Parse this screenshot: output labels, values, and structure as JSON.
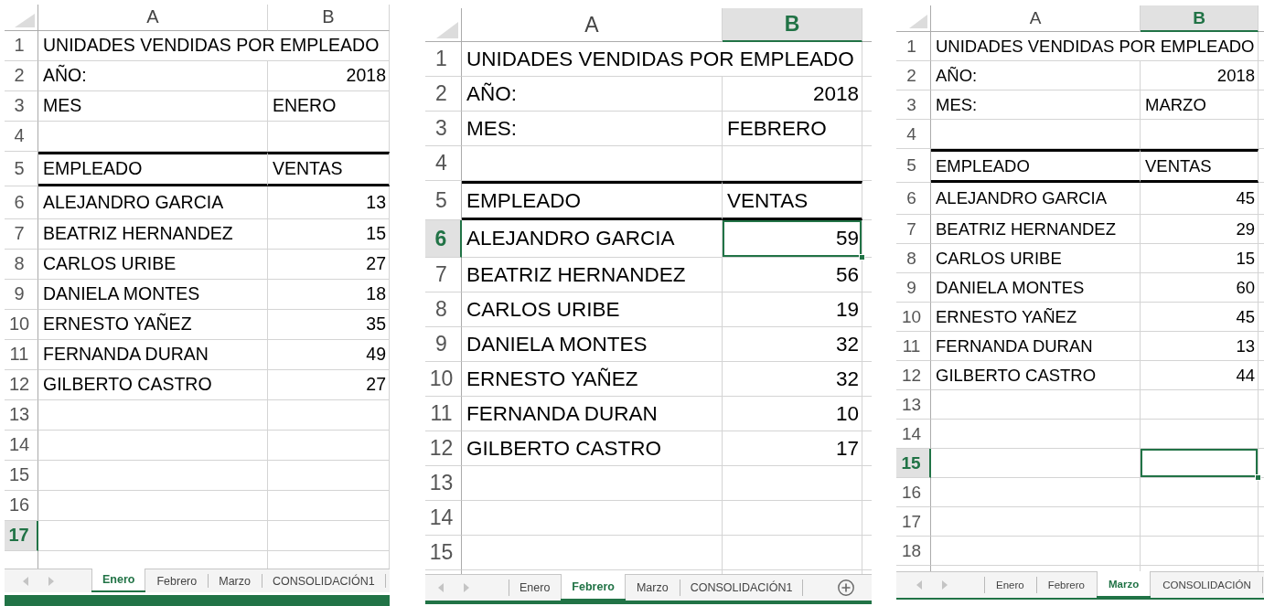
{
  "sheets": [
    {
      "columns": [
        {
          "label": "A",
          "selected": false
        },
        {
          "label": "B",
          "selected": false
        }
      ],
      "rows": [
        {
          "number": "1",
          "selected": false,
          "cells": [
            {
              "text": "UNIDADES VENDIDAS POR EMPLEADO",
              "kind": "title",
              "selected": false
            }
          ]
        },
        {
          "number": "2",
          "selected": false,
          "cells": [
            {
              "text": "AÑO:",
              "kind": "text",
              "selected": false
            },
            {
              "text": "2018",
              "kind": "number",
              "selected": false
            }
          ]
        },
        {
          "number": "3",
          "selected": false,
          "cells": [
            {
              "text": "MES",
              "kind": "text",
              "selected": false
            },
            {
              "text": "ENERO",
              "kind": "text",
              "selected": false
            }
          ]
        },
        {
          "number": "4",
          "selected": false,
          "cells": [
            {
              "selected": false
            },
            {
              "selected": false
            }
          ]
        },
        {
          "number": "5",
          "selected": false,
          "cells": [
            {
              "text": "EMPLEADO",
              "kind": "heading",
              "selected": false
            },
            {
              "text": "VENTAS",
              "kind": "heading",
              "selected": false
            }
          ]
        },
        {
          "number": "6",
          "selected": false,
          "cells": [
            {
              "text": "ALEJANDRO GARCIA",
              "kind": "text",
              "selected": false
            },
            {
              "text": "13",
              "kind": "number",
              "selected": false
            }
          ]
        },
        {
          "number": "7",
          "selected": false,
          "cells": [
            {
              "text": "BEATRIZ HERNANDEZ",
              "kind": "text",
              "selected": false
            },
            {
              "text": "15",
              "kind": "number",
              "selected": false
            }
          ]
        },
        {
          "number": "8",
          "selected": false,
          "cells": [
            {
              "text": "CARLOS URIBE",
              "kind": "text",
              "selected": false
            },
            {
              "text": "27",
              "kind": "number",
              "selected": false
            }
          ]
        },
        {
          "number": "9",
          "selected": false,
          "cells": [
            {
              "text": "DANIELA MONTES",
              "kind": "text",
              "selected": false
            },
            {
              "text": "18",
              "kind": "number",
              "selected": false
            }
          ]
        },
        {
          "number": "10",
          "selected": false,
          "cells": [
            {
              "text": "ERNESTO YAÑEZ",
              "kind": "text",
              "selected": false
            },
            {
              "text": "35",
              "kind": "number",
              "selected": false
            }
          ]
        },
        {
          "number": "11",
          "selected": false,
          "cells": [
            {
              "text": "FERNANDA DURAN",
              "kind": "text",
              "selected": false
            },
            {
              "text": "49",
              "kind": "number",
              "selected": false
            }
          ]
        },
        {
          "number": "12",
          "selected": false,
          "cells": [
            {
              "text": "GILBERTO CASTRO",
              "kind": "text",
              "selected": false
            },
            {
              "text": "27",
              "kind": "number",
              "selected": false
            }
          ]
        },
        {
          "number": "13",
          "selected": false,
          "cells": [
            {
              "selected": false
            },
            {
              "selected": false
            }
          ]
        },
        {
          "number": "14",
          "selected": false,
          "cells": [
            {
              "selected": false
            },
            {
              "selected": false
            }
          ]
        },
        {
          "number": "15",
          "selected": false,
          "cells": [
            {
              "selected": false
            },
            {
              "selected": false
            }
          ]
        },
        {
          "number": "16",
          "selected": false,
          "cells": [
            {
              "selected": false
            },
            {
              "selected": false
            }
          ]
        },
        {
          "number": "17",
          "selected": true,
          "cells": [
            {
              "selected": false
            },
            {
              "selected": false
            }
          ]
        }
      ],
      "tabs": [
        {
          "label": "Enero",
          "selected": true
        },
        {
          "label": "Febrero",
          "selected": false
        },
        {
          "label": "Marzo",
          "selected": false
        },
        {
          "label": "CONSOLIDACIÓN1",
          "selected": false
        }
      ]
    },
    {
      "columns": [
        {
          "label": "A",
          "selected": false
        },
        {
          "label": "B",
          "selected": true
        }
      ],
      "rows": [
        {
          "number": "1",
          "selected": false,
          "cells": [
            {
              "text": "UNIDADES VENDIDAS POR EMPLEADO",
              "kind": "title",
              "selected": false
            }
          ]
        },
        {
          "number": "2",
          "selected": false,
          "cells": [
            {
              "text": "AÑO:",
              "kind": "text",
              "selected": false
            },
            {
              "text": "2018",
              "kind": "number",
              "selected": false
            }
          ]
        },
        {
          "number": "3",
          "selected": false,
          "cells": [
            {
              "text": "MES:",
              "kind": "text",
              "selected": false
            },
            {
              "text": "FEBRERO",
              "kind": "text",
              "selected": false
            }
          ]
        },
        {
          "number": "4",
          "selected": false,
          "cells": [
            {
              "selected": false
            },
            {
              "selected": false
            }
          ]
        },
        {
          "number": "5",
          "selected": false,
          "cells": [
            {
              "text": "EMPLEADO",
              "kind": "heading",
              "selected": false
            },
            {
              "text": "VENTAS",
              "kind": "heading",
              "selected": false
            }
          ]
        },
        {
          "number": "6",
          "selected": true,
          "cells": [
            {
              "text": "ALEJANDRO GARCIA",
              "kind": "text",
              "selected": false
            },
            {
              "text": "59",
              "kind": "number",
              "selected": true
            }
          ]
        },
        {
          "number": "7",
          "selected": false,
          "cells": [
            {
              "text": "BEATRIZ HERNANDEZ",
              "kind": "text",
              "selected": false
            },
            {
              "text": "56",
              "kind": "number",
              "selected": false
            }
          ]
        },
        {
          "number": "8",
          "selected": false,
          "cells": [
            {
              "text": "CARLOS URIBE",
              "kind": "text",
              "selected": false
            },
            {
              "text": "19",
              "kind": "number",
              "selected": false
            }
          ]
        },
        {
          "number": "9",
          "selected": false,
          "cells": [
            {
              "text": "DANIELA MONTES",
              "kind": "text",
              "selected": false
            },
            {
              "text": "32",
              "kind": "number",
              "selected": false
            }
          ]
        },
        {
          "number": "10",
          "selected": false,
          "cells": [
            {
              "text": "ERNESTO YAÑEZ",
              "kind": "text",
              "selected": false
            },
            {
              "text": "32",
              "kind": "number",
              "selected": false
            }
          ]
        },
        {
          "number": "11",
          "selected": false,
          "cells": [
            {
              "text": "FERNANDA DURAN",
              "kind": "text",
              "selected": false
            },
            {
              "text": "10",
              "kind": "number",
              "selected": false
            }
          ]
        },
        {
          "number": "12",
          "selected": false,
          "cells": [
            {
              "text": "GILBERTO CASTRO",
              "kind": "text",
              "selected": false
            },
            {
              "text": "17",
              "kind": "number",
              "selected": false
            }
          ]
        },
        {
          "number": "13",
          "selected": false,
          "cells": [
            {
              "selected": false
            },
            {
              "selected": false
            }
          ]
        },
        {
          "number": "14",
          "selected": false,
          "cells": [
            {
              "selected": false
            },
            {
              "selected": false
            }
          ]
        },
        {
          "number": "15",
          "selected": false,
          "cells": [
            {
              "selected": false
            },
            {
              "selected": false
            }
          ]
        }
      ],
      "tabs": [
        {
          "label": "Enero",
          "selected": false
        },
        {
          "label": "Febrero",
          "selected": true
        },
        {
          "label": "Marzo",
          "selected": false
        },
        {
          "label": "CONSOLIDACIÓN1",
          "selected": false
        }
      ],
      "add_sheet_button": true
    },
    {
      "columns": [
        {
          "label": "A",
          "selected": false
        },
        {
          "label": "B",
          "selected": true
        }
      ],
      "rows": [
        {
          "number": "1",
          "selected": false,
          "cells": [
            {
              "text": "UNIDADES VENDIDAS POR EMPLEADO",
              "kind": "title",
              "selected": false
            }
          ]
        },
        {
          "number": "2",
          "selected": false,
          "cells": [
            {
              "text": "AÑO:",
              "kind": "text",
              "selected": false
            },
            {
              "text": "2018",
              "kind": "number",
              "selected": false
            }
          ]
        },
        {
          "number": "3",
          "selected": false,
          "cells": [
            {
              "text": "MES:",
              "kind": "text",
              "selected": false
            },
            {
              "text": "MARZO",
              "kind": "text",
              "selected": false
            }
          ]
        },
        {
          "number": "4",
          "selected": false,
          "cells": [
            {
              "selected": false
            },
            {
              "selected": false
            }
          ]
        },
        {
          "number": "5",
          "selected": false,
          "cells": [
            {
              "text": "EMPLEADO",
              "kind": "heading",
              "selected": false
            },
            {
              "text": "VENTAS",
              "kind": "heading",
              "selected": false
            }
          ]
        },
        {
          "number": "6",
          "selected": false,
          "cells": [
            {
              "text": "ALEJANDRO GARCIA",
              "kind": "text",
              "selected": false
            },
            {
              "text": "45",
              "kind": "number",
              "selected": false
            }
          ]
        },
        {
          "number": "7",
          "selected": false,
          "cells": [
            {
              "text": "BEATRIZ HERNANDEZ",
              "kind": "text",
              "selected": false
            },
            {
              "text": "29",
              "kind": "number",
              "selected": false
            }
          ]
        },
        {
          "number": "8",
          "selected": false,
          "cells": [
            {
              "text": "CARLOS URIBE",
              "kind": "text",
              "selected": false
            },
            {
              "text": "15",
              "kind": "number",
              "selected": false
            }
          ]
        },
        {
          "number": "9",
          "selected": false,
          "cells": [
            {
              "text": "DANIELA MONTES",
              "kind": "text",
              "selected": false
            },
            {
              "text": "60",
              "kind": "number",
              "selected": false
            }
          ]
        },
        {
          "number": "10",
          "selected": false,
          "cells": [
            {
              "text": "ERNESTO YAÑEZ",
              "kind": "text",
              "selected": false
            },
            {
              "text": "45",
              "kind": "number",
              "selected": false
            }
          ]
        },
        {
          "number": "11",
          "selected": false,
          "cells": [
            {
              "text": "FERNANDA DURAN",
              "kind": "text",
              "selected": false
            },
            {
              "text": "13",
              "kind": "number",
              "selected": false
            }
          ]
        },
        {
          "number": "12",
          "selected": false,
          "cells": [
            {
              "text": "GILBERTO CASTRO",
              "kind": "text",
              "selected": false
            },
            {
              "text": "44",
              "kind": "number",
              "selected": false
            }
          ]
        },
        {
          "number": "13",
          "selected": false,
          "cells": [
            {
              "selected": false
            },
            {
              "selected": false
            }
          ]
        },
        {
          "number": "14",
          "selected": false,
          "cells": [
            {
              "selected": false
            },
            {
              "selected": false
            }
          ]
        },
        {
          "number": "15",
          "selected": true,
          "cells": [
            {
              "selected": false
            },
            {
              "selected": true
            }
          ]
        },
        {
          "number": "16",
          "selected": false,
          "cells": [
            {
              "selected": false
            },
            {
              "selected": false
            }
          ]
        },
        {
          "number": "17",
          "selected": false,
          "cells": [
            {
              "selected": false
            },
            {
              "selected": false
            }
          ]
        },
        {
          "number": "18",
          "selected": false,
          "cells": [
            {
              "selected": false
            },
            {
              "selected": false
            }
          ]
        }
      ],
      "tabs": [
        {
          "label": "Enero",
          "selected": false
        },
        {
          "label": "Febrero",
          "selected": false
        },
        {
          "label": "Marzo",
          "selected": true
        },
        {
          "label": "CONSOLIDACIÓN",
          "selected": false
        }
      ]
    }
  ]
}
